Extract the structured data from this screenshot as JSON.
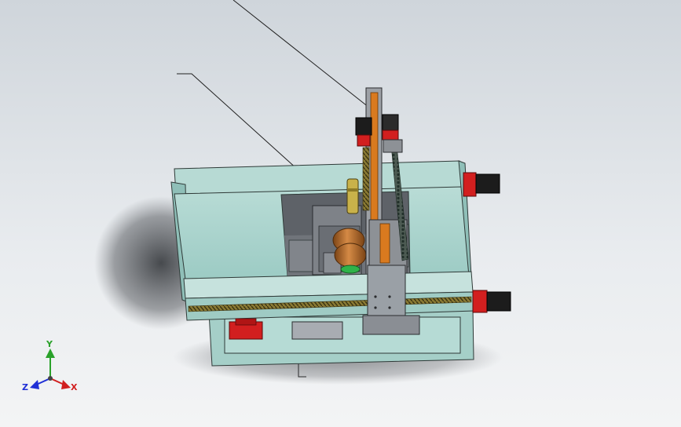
{
  "viewport": {
    "background_top": "#cfd5db",
    "background_bottom": "#f3f4f5"
  },
  "model": {
    "frame_color": "#a9d1cb",
    "frame_dark": "#7fb3ad",
    "steel_color": "#8c8f94",
    "steel_dark": "#4b4e53",
    "motor_red": "#d21f1f",
    "motor_black": "#1c1c1c",
    "rail_orange": "#d97a1f",
    "roller_copper": "#b8702e",
    "gear_green": "#2fb34a",
    "screw_gold": "#a08a3a"
  },
  "triad": {
    "y_label": "Y",
    "z_label": "Z",
    "x_label": "X",
    "y_color": "#2aa12a",
    "z_color": "#1f2fd6",
    "x_color": "#d11f1f"
  }
}
